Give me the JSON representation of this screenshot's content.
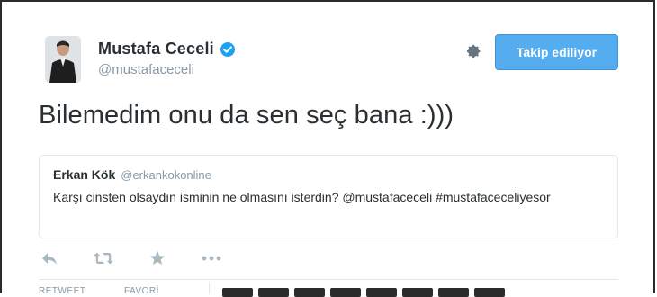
{
  "author": {
    "name": "Mustafa Ceceli",
    "handle": "@mustafaceceli",
    "verified": true
  },
  "follow_button": {
    "label": "Takip ediliyor",
    "color": "#55acee"
  },
  "tweet": {
    "text": "Bilemedim onu da sen seç bana :)))"
  },
  "quoted_tweet": {
    "name": "Erkan Kök",
    "handle": "@erkankokonline",
    "text": "Karşı cinsten olsaydın isminin ne olmasını isterdin? @mustafaceceli #mustafaceceliyesor"
  },
  "actions": [
    {
      "icon": "reply-icon"
    },
    {
      "icon": "retweet-icon"
    },
    {
      "icon": "favorite-icon"
    },
    {
      "icon": "more-icon"
    }
  ],
  "stats": {
    "retweet_label": "RETWEET",
    "favorite_label": "FAVORİ"
  },
  "colors": {
    "accent": "#55acee",
    "text": "#292f33",
    "muted": "#8899a6",
    "verified": "#1da1f2"
  }
}
